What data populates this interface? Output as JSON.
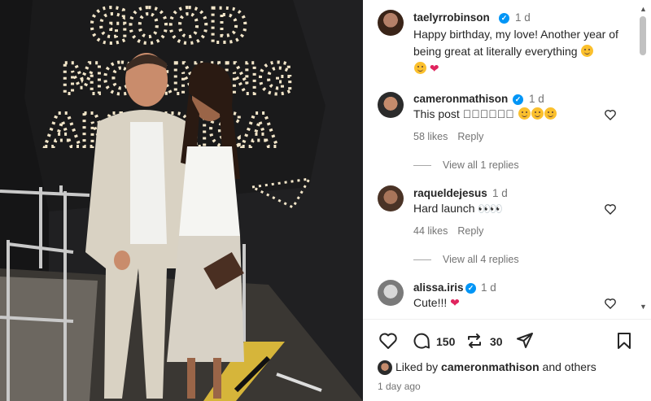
{
  "photo": {
    "sign_line1": "GOOD",
    "sign_line2": "MORNING",
    "sign_line3": "AMERICA"
  },
  "comments": [
    {
      "username": "taelyrrobinson",
      "verified": true,
      "ago": "1 d",
      "text": "Happy birthday, my love! Another year of being great at literally everything",
      "is_caption": true
    },
    {
      "username": "cameronmathison",
      "verified": true,
      "ago": "1 d",
      "text": "This post \u0000\u0000\u0000\u0000\u0000\u0000",
      "likes": "58 likes",
      "reply": "Reply",
      "view_replies": "View all 1 replies"
    },
    {
      "username": "raqueldejesus",
      "verified": false,
      "ago": "1 d",
      "text": "Hard launch",
      "likes": "44 likes",
      "reply": "Reply",
      "view_replies": "View all 4 replies"
    },
    {
      "username": "alissa.iris",
      "verified": true,
      "ago": "1 d",
      "text": "Cute!!!"
    }
  ],
  "actions": {
    "comment_count": "150",
    "repost_count": "30"
  },
  "likes": {
    "prefix": "Liked by",
    "user": "cameronmathison",
    "suffix": "and others"
  },
  "timestamp": "1 day ago",
  "colors": {
    "verified": "#0095f6",
    "heart": "#e0245e",
    "muted_text": "#737373"
  }
}
